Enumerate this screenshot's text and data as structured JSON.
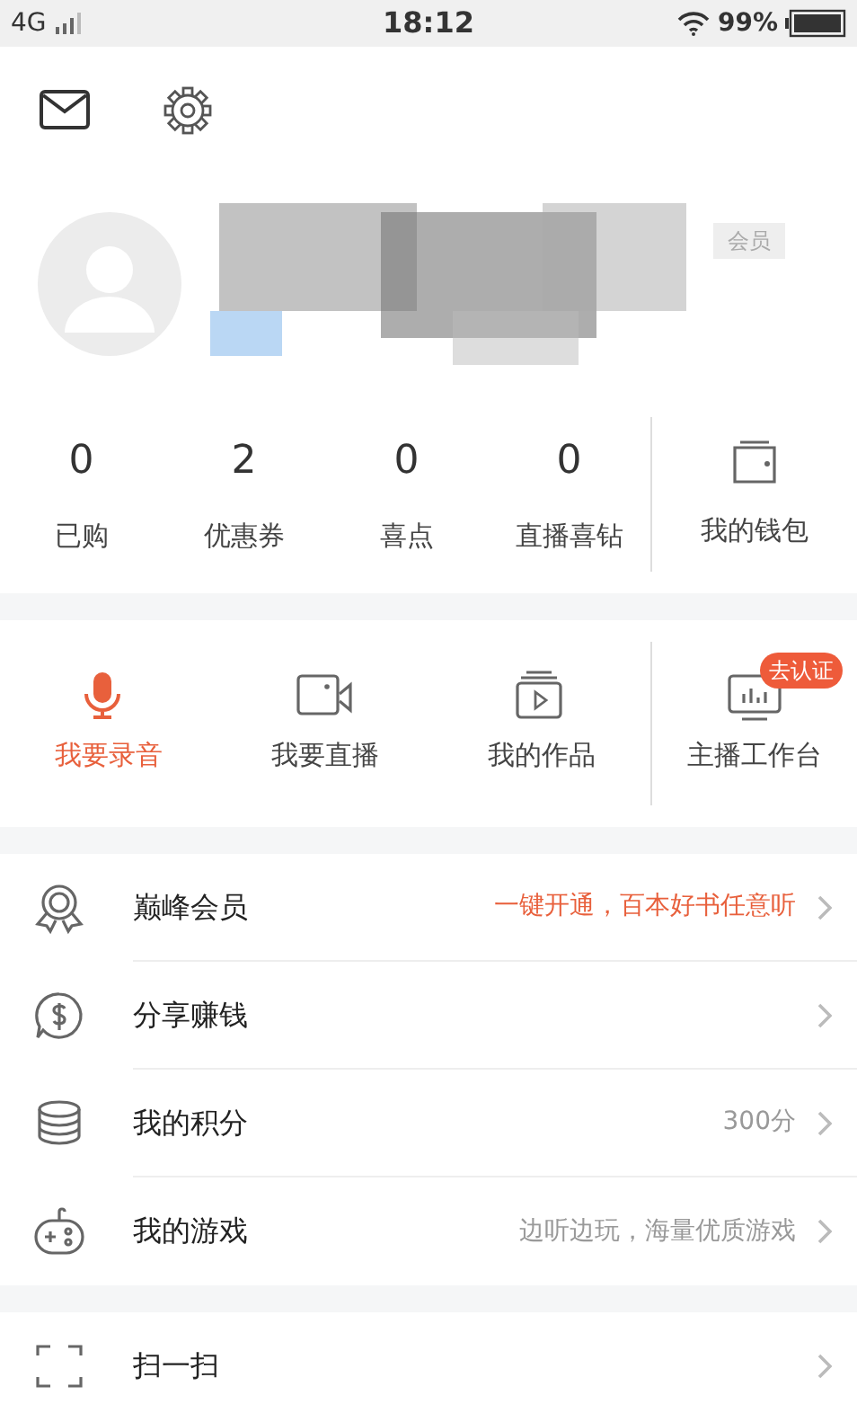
{
  "status_bar": {
    "network": "4G",
    "time": "18:12",
    "battery": "99%"
  },
  "profile": {
    "tag": "会员"
  },
  "stats": [
    {
      "value": "0",
      "label": "已购"
    },
    {
      "value": "2",
      "label": "优惠券"
    },
    {
      "value": "0",
      "label": "喜点"
    },
    {
      "value": "0",
      "label": "直播喜钻"
    }
  ],
  "wallet": {
    "label": "我的钱包"
  },
  "actions": [
    {
      "label": "我要录音",
      "selected": true
    },
    {
      "label": "我要直播",
      "selected": false
    },
    {
      "label": "我的作品",
      "selected": false
    }
  ],
  "workbench": {
    "label": "主播工作台",
    "badge": "去认证"
  },
  "menu_groups": [
    [
      {
        "label": "巅峰会员",
        "detail": "一键开通，百本好书任意听",
        "highlight": true
      },
      {
        "label": "分享赚钱"
      },
      {
        "label": "我的积分",
        "detail": "300分",
        "highlight": false
      },
      {
        "label": "我的游戏",
        "detail": "边听边玩，海量优质游戏",
        "highlight": false
      }
    ],
    [
      {
        "label": "扫一扫"
      }
    ]
  ]
}
